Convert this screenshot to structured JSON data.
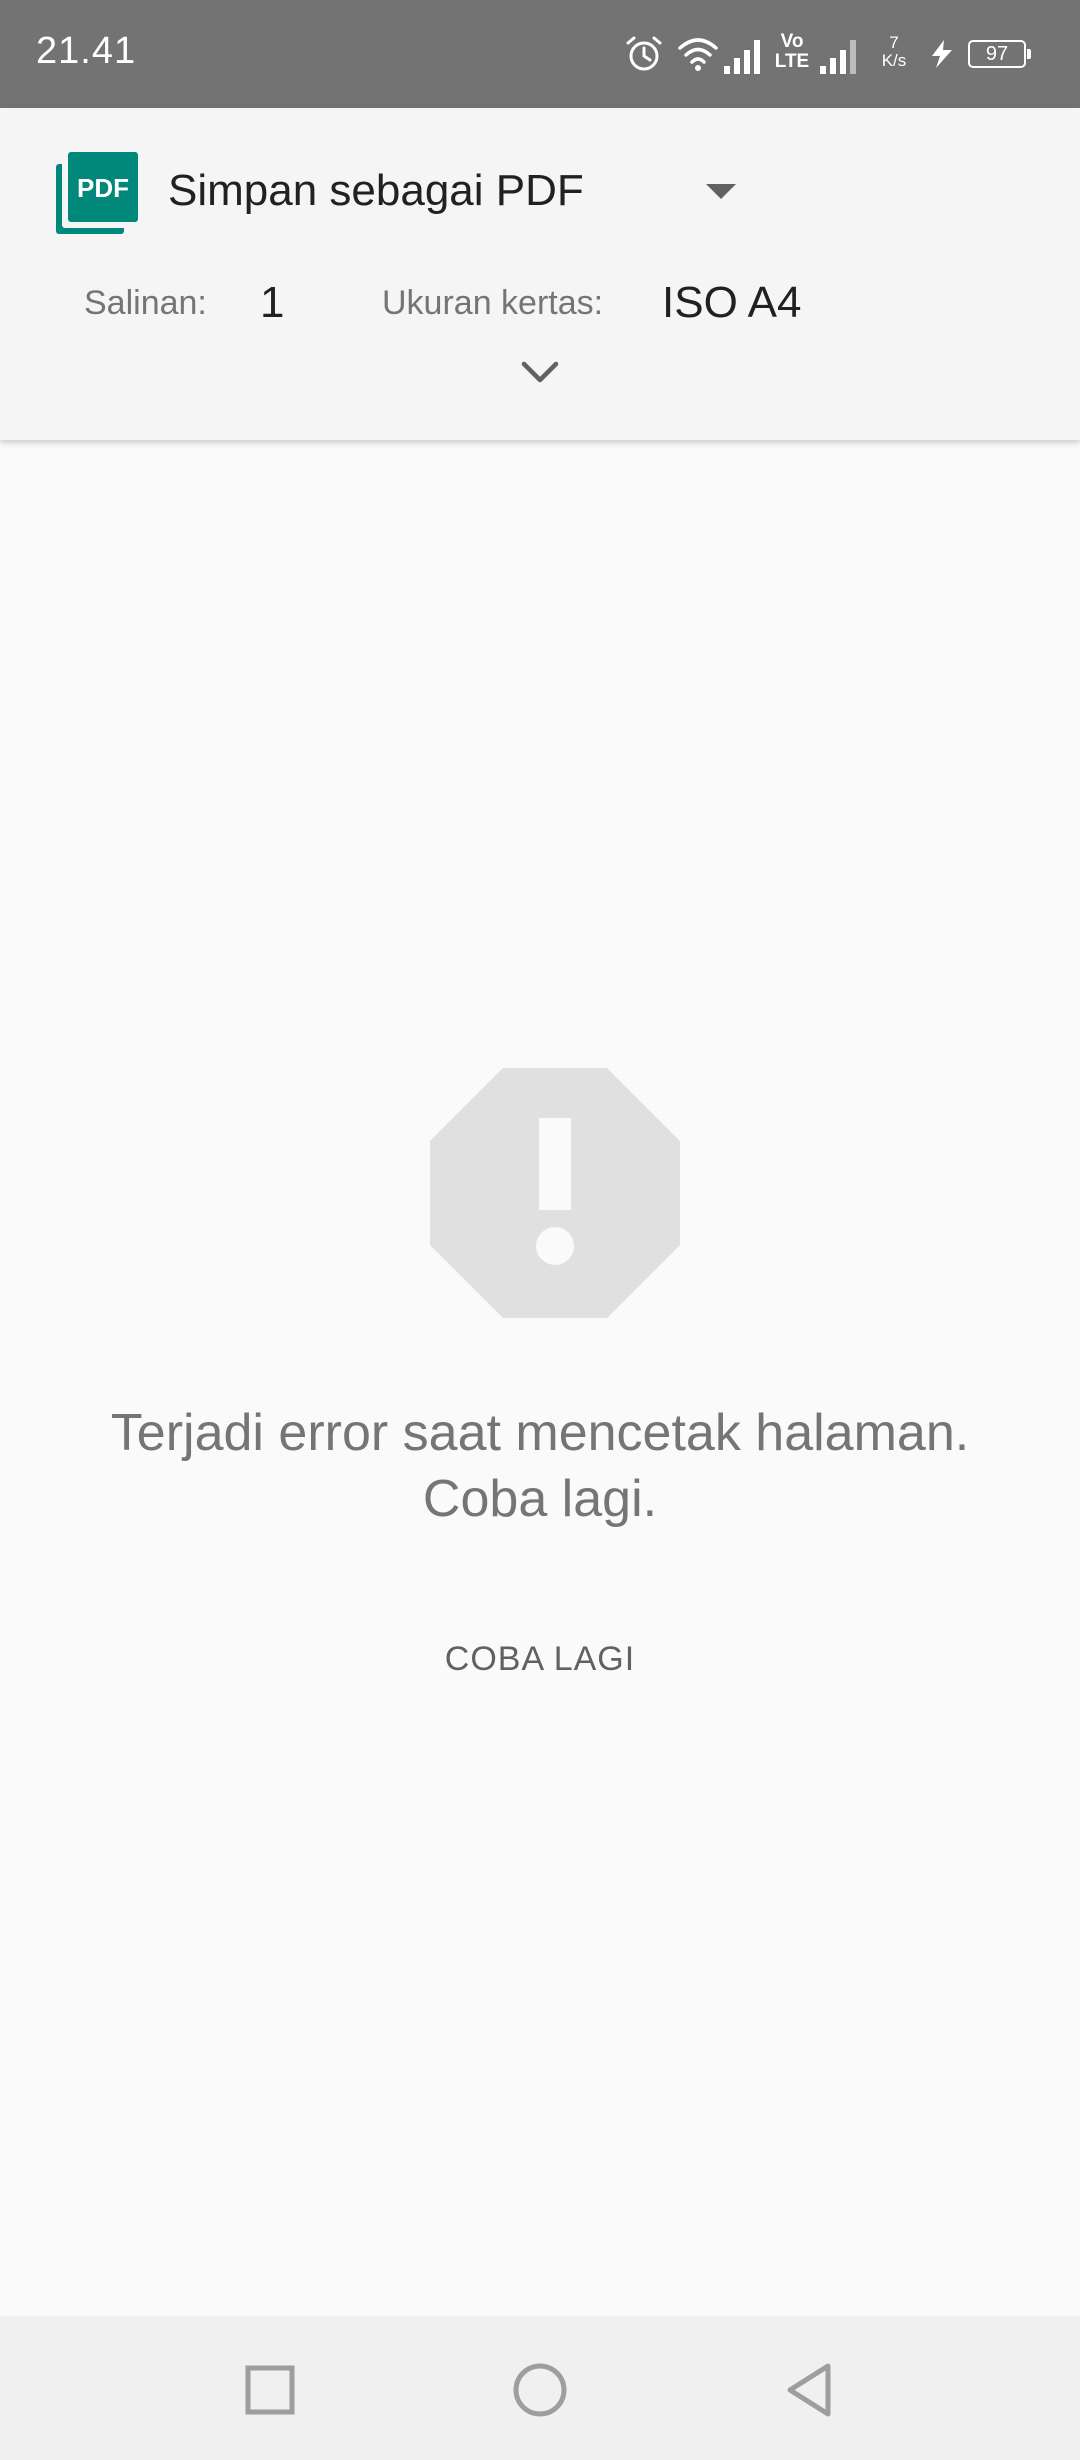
{
  "status_bar": {
    "time": "21.41",
    "network_speed_value": "7",
    "network_speed_unit": "K/s",
    "volte_top": "Vo",
    "volte_bottom": "LTE",
    "battery": "97",
    "icons": [
      "alarm-icon",
      "wifi-icon",
      "signal-icon",
      "volte-icon",
      "signal-icon",
      "charging-icon",
      "battery-icon"
    ]
  },
  "header": {
    "printer_name": "Simpan sebagai PDF",
    "pdf_icon_text": "PDF",
    "copies_label": "Salinan:",
    "copies_value": "1",
    "paper_size_label": "Ukuran kertas:",
    "paper_size_value": "ISO A4",
    "accent_color": "#00897b"
  },
  "error": {
    "message_line1": "Terjadi error saat mencetak halaman.",
    "message_line2": "Coba lagi.",
    "retry_label": "COBA LAGI"
  },
  "nav_bar": {
    "buttons": [
      "recents-icon",
      "home-icon",
      "back-icon"
    ]
  }
}
